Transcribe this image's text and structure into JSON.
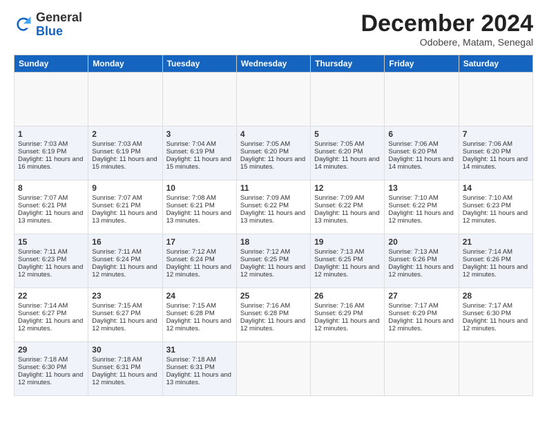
{
  "header": {
    "logo": {
      "line1": "General",
      "line2": "Blue"
    },
    "title": "December 2024",
    "location": "Odobere, Matam, Senegal"
  },
  "calendar": {
    "days_of_week": [
      "Sunday",
      "Monday",
      "Tuesday",
      "Wednesday",
      "Thursday",
      "Friday",
      "Saturday"
    ],
    "weeks": [
      [
        null,
        null,
        null,
        null,
        null,
        null,
        null
      ]
    ],
    "cells": [
      [
        {
          "day": null,
          "text": ""
        },
        {
          "day": null,
          "text": ""
        },
        {
          "day": null,
          "text": ""
        },
        {
          "day": null,
          "text": ""
        },
        {
          "day": null,
          "text": ""
        },
        {
          "day": null,
          "text": ""
        },
        {
          "day": null,
          "text": ""
        }
      ],
      [
        {
          "day": "1",
          "text": "Sunrise: 7:03 AM\nSunset: 6:19 PM\nDaylight: 11 hours and 16 minutes."
        },
        {
          "day": "2",
          "text": "Sunrise: 7:03 AM\nSunset: 6:19 PM\nDaylight: 11 hours and 15 minutes."
        },
        {
          "day": "3",
          "text": "Sunrise: 7:04 AM\nSunset: 6:19 PM\nDaylight: 11 hours and 15 minutes."
        },
        {
          "day": "4",
          "text": "Sunrise: 7:05 AM\nSunset: 6:20 PM\nDaylight: 11 hours and 15 minutes."
        },
        {
          "day": "5",
          "text": "Sunrise: 7:05 AM\nSunset: 6:20 PM\nDaylight: 11 hours and 14 minutes."
        },
        {
          "day": "6",
          "text": "Sunrise: 7:06 AM\nSunset: 6:20 PM\nDaylight: 11 hours and 14 minutes."
        },
        {
          "day": "7",
          "text": "Sunrise: 7:06 AM\nSunset: 6:20 PM\nDaylight: 11 hours and 14 minutes."
        }
      ],
      [
        {
          "day": "8",
          "text": "Sunrise: 7:07 AM\nSunset: 6:21 PM\nDaylight: 11 hours and 13 minutes."
        },
        {
          "day": "9",
          "text": "Sunrise: 7:07 AM\nSunset: 6:21 PM\nDaylight: 11 hours and 13 minutes."
        },
        {
          "day": "10",
          "text": "Sunrise: 7:08 AM\nSunset: 6:21 PM\nDaylight: 11 hours and 13 minutes."
        },
        {
          "day": "11",
          "text": "Sunrise: 7:09 AM\nSunset: 6:22 PM\nDaylight: 11 hours and 13 minutes."
        },
        {
          "day": "12",
          "text": "Sunrise: 7:09 AM\nSunset: 6:22 PM\nDaylight: 11 hours and 13 minutes."
        },
        {
          "day": "13",
          "text": "Sunrise: 7:10 AM\nSunset: 6:22 PM\nDaylight: 11 hours and 12 minutes."
        },
        {
          "day": "14",
          "text": "Sunrise: 7:10 AM\nSunset: 6:23 PM\nDaylight: 11 hours and 12 minutes."
        }
      ],
      [
        {
          "day": "15",
          "text": "Sunrise: 7:11 AM\nSunset: 6:23 PM\nDaylight: 11 hours and 12 minutes."
        },
        {
          "day": "16",
          "text": "Sunrise: 7:11 AM\nSunset: 6:24 PM\nDaylight: 11 hours and 12 minutes."
        },
        {
          "day": "17",
          "text": "Sunrise: 7:12 AM\nSunset: 6:24 PM\nDaylight: 11 hours and 12 minutes."
        },
        {
          "day": "18",
          "text": "Sunrise: 7:12 AM\nSunset: 6:25 PM\nDaylight: 11 hours and 12 minutes."
        },
        {
          "day": "19",
          "text": "Sunrise: 7:13 AM\nSunset: 6:25 PM\nDaylight: 11 hours and 12 minutes."
        },
        {
          "day": "20",
          "text": "Sunrise: 7:13 AM\nSunset: 6:26 PM\nDaylight: 11 hours and 12 minutes."
        },
        {
          "day": "21",
          "text": "Sunrise: 7:14 AM\nSunset: 6:26 PM\nDaylight: 11 hours and 12 minutes."
        }
      ],
      [
        {
          "day": "22",
          "text": "Sunrise: 7:14 AM\nSunset: 6:27 PM\nDaylight: 11 hours and 12 minutes."
        },
        {
          "day": "23",
          "text": "Sunrise: 7:15 AM\nSunset: 6:27 PM\nDaylight: 11 hours and 12 minutes."
        },
        {
          "day": "24",
          "text": "Sunrise: 7:15 AM\nSunset: 6:28 PM\nDaylight: 11 hours and 12 minutes."
        },
        {
          "day": "25",
          "text": "Sunrise: 7:16 AM\nSunset: 6:28 PM\nDaylight: 11 hours and 12 minutes."
        },
        {
          "day": "26",
          "text": "Sunrise: 7:16 AM\nSunset: 6:29 PM\nDaylight: 11 hours and 12 minutes."
        },
        {
          "day": "27",
          "text": "Sunrise: 7:17 AM\nSunset: 6:29 PM\nDaylight: 11 hours and 12 minutes."
        },
        {
          "day": "28",
          "text": "Sunrise: 7:17 AM\nSunset: 6:30 PM\nDaylight: 11 hours and 12 minutes."
        }
      ],
      [
        {
          "day": "29",
          "text": "Sunrise: 7:18 AM\nSunset: 6:30 PM\nDaylight: 11 hours and 12 minutes."
        },
        {
          "day": "30",
          "text": "Sunrise: 7:18 AM\nSunset: 6:31 PM\nDaylight: 11 hours and 12 minutes."
        },
        {
          "day": "31",
          "text": "Sunrise: 7:18 AM\nSunset: 6:31 PM\nDaylight: 11 hours and 13 minutes."
        },
        null,
        null,
        null,
        null
      ]
    ]
  }
}
